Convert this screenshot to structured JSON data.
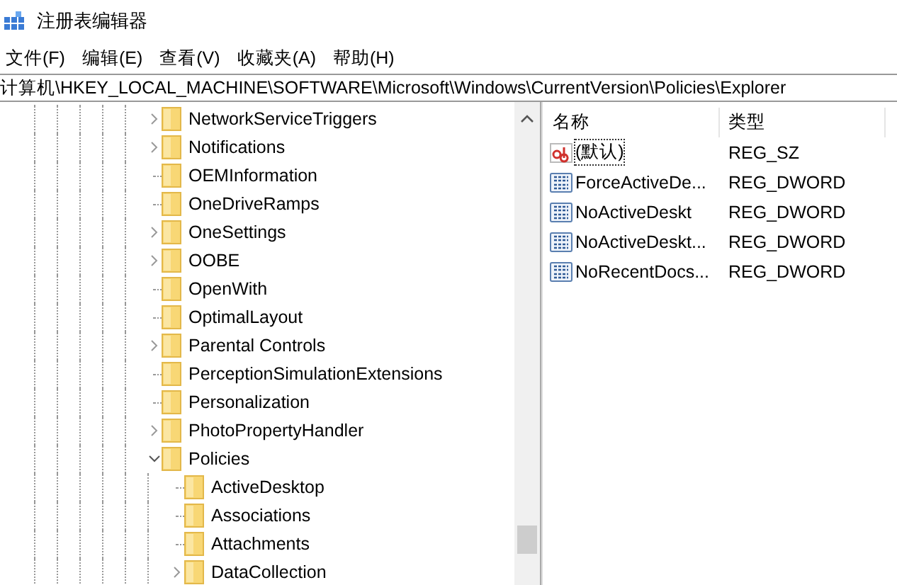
{
  "window": {
    "title": "注册表编辑器"
  },
  "menu": [
    "文件(F)",
    "编辑(E)",
    "查看(V)",
    "收藏夹(A)",
    "帮助(H)"
  ],
  "address": "计算机\\HKEY_LOCAL_MACHINE\\SOFTWARE\\Microsoft\\Windows\\CurrentVersion\\Policies\\Explorer",
  "tree": [
    {
      "label": "NetworkServiceTriggers",
      "kind": "branch",
      "expanded": false
    },
    {
      "label": "Notifications",
      "kind": "branch",
      "expanded": false
    },
    {
      "label": "OEMInformation",
      "kind": "leaf"
    },
    {
      "label": "OneDriveRamps",
      "kind": "leaf"
    },
    {
      "label": "OneSettings",
      "kind": "branch",
      "expanded": false
    },
    {
      "label": "OOBE",
      "kind": "branch",
      "expanded": false
    },
    {
      "label": "OpenWith",
      "kind": "leaf"
    },
    {
      "label": "OptimalLayout",
      "kind": "leaf"
    },
    {
      "label": "Parental Controls",
      "kind": "branch",
      "expanded": false
    },
    {
      "label": "PerceptionSimulationExtensions",
      "kind": "leaf"
    },
    {
      "label": "Personalization",
      "kind": "leaf"
    },
    {
      "label": "PhotoPropertyHandler",
      "kind": "branch",
      "expanded": false
    },
    {
      "label": "Policies",
      "kind": "branch",
      "expanded": true,
      "children": [
        {
          "label": "ActiveDesktop",
          "kind": "leaf"
        },
        {
          "label": "Associations",
          "kind": "leaf"
        },
        {
          "label": "Attachments",
          "kind": "leaf"
        },
        {
          "label": "DataCollection",
          "kind": "branch",
          "expanded": false
        }
      ]
    }
  ],
  "values": {
    "columns": [
      "名称",
      "类型"
    ],
    "rows": [
      {
        "name": "(默认)",
        "type": "REG_SZ",
        "kind": "string",
        "focused": true
      },
      {
        "name": "ForceActiveDe...",
        "type": "REG_DWORD",
        "kind": "dword",
        "focused": false
      },
      {
        "name": "NoActiveDeskt",
        "type": "REG_DWORD",
        "kind": "dword",
        "focused": false
      },
      {
        "name": "NoActiveDeskt...",
        "type": "REG_DWORD",
        "kind": "dword",
        "focused": false
      },
      {
        "name": "NoRecentDocs...",
        "type": "REG_DWORD",
        "kind": "dword",
        "focused": false
      }
    ]
  }
}
